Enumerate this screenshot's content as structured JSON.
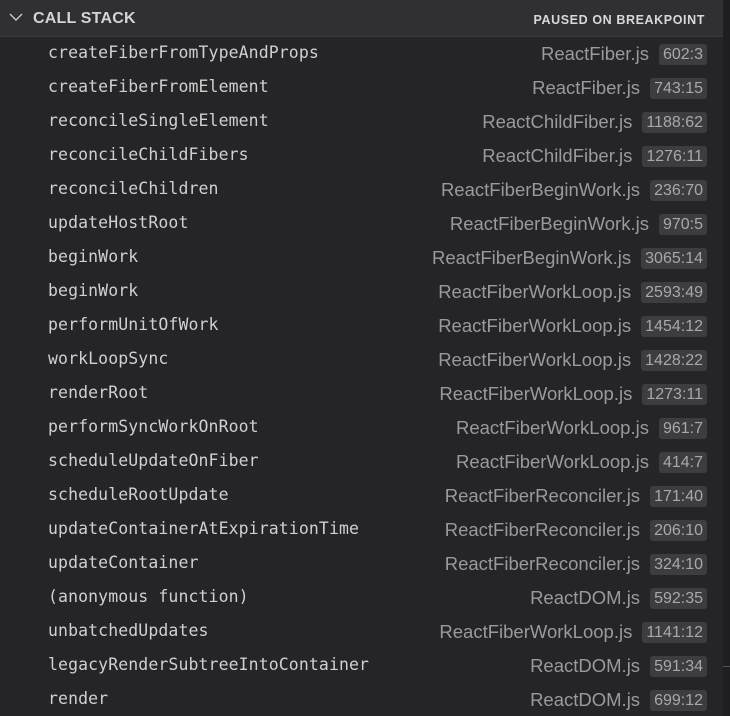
{
  "header": {
    "title": "CALL STACK",
    "status": "PAUSED ON BREAKPOINT",
    "collapse_icon": "chevron-down-icon"
  },
  "colors": {
    "header_bg": "#303034",
    "body_bg": "#252528",
    "function_text": "#d0d0d0",
    "file_text": "#9a9a9e",
    "badge_bg": "#3d3d41"
  },
  "frames": [
    {
      "function": "createFiberFromTypeAndProps",
      "file": "ReactFiber.js",
      "location": "602:3"
    },
    {
      "function": "createFiberFromElement",
      "file": "ReactFiber.js",
      "location": "743:15"
    },
    {
      "function": "reconcileSingleElement",
      "file": "ReactChildFiber.js",
      "location": "1188:62"
    },
    {
      "function": "reconcileChildFibers",
      "file": "ReactChildFiber.js",
      "location": "1276:11"
    },
    {
      "function": "reconcileChildren",
      "file": "ReactFiberBeginWork.js",
      "location": "236:70"
    },
    {
      "function": "updateHostRoot",
      "file": "ReactFiberBeginWork.js",
      "location": "970:5"
    },
    {
      "function": "beginWork",
      "file": "ReactFiberBeginWork.js",
      "location": "3065:14"
    },
    {
      "function": "beginWork",
      "file": "ReactFiberWorkLoop.js",
      "location": "2593:49"
    },
    {
      "function": "performUnitOfWork",
      "file": "ReactFiberWorkLoop.js",
      "location": "1454:12"
    },
    {
      "function": "workLoopSync",
      "file": "ReactFiberWorkLoop.js",
      "location": "1428:22"
    },
    {
      "function": "renderRoot",
      "file": "ReactFiberWorkLoop.js",
      "location": "1273:11"
    },
    {
      "function": "performSyncWorkOnRoot",
      "file": "ReactFiberWorkLoop.js",
      "location": "961:7"
    },
    {
      "function": "scheduleUpdateOnFiber",
      "file": "ReactFiberWorkLoop.js",
      "location": "414:7"
    },
    {
      "function": "scheduleRootUpdate",
      "file": "ReactFiberReconciler.js",
      "location": "171:40"
    },
    {
      "function": "updateContainerAtExpirationTime",
      "file": "ReactFiberReconciler.js",
      "location": "206:10"
    },
    {
      "function": "updateContainer",
      "file": "ReactFiberReconciler.js",
      "location": "324:10"
    },
    {
      "function": "(anonymous function)",
      "file": "ReactDOM.js",
      "location": "592:35"
    },
    {
      "function": "unbatchedUpdates",
      "file": "ReactFiberWorkLoop.js",
      "location": "1141:12"
    },
    {
      "function": "legacyRenderSubtreeIntoContainer",
      "file": "ReactDOM.js",
      "location": "591:34"
    },
    {
      "function": "render",
      "file": "ReactDOM.js",
      "location": "699:12"
    }
  ]
}
